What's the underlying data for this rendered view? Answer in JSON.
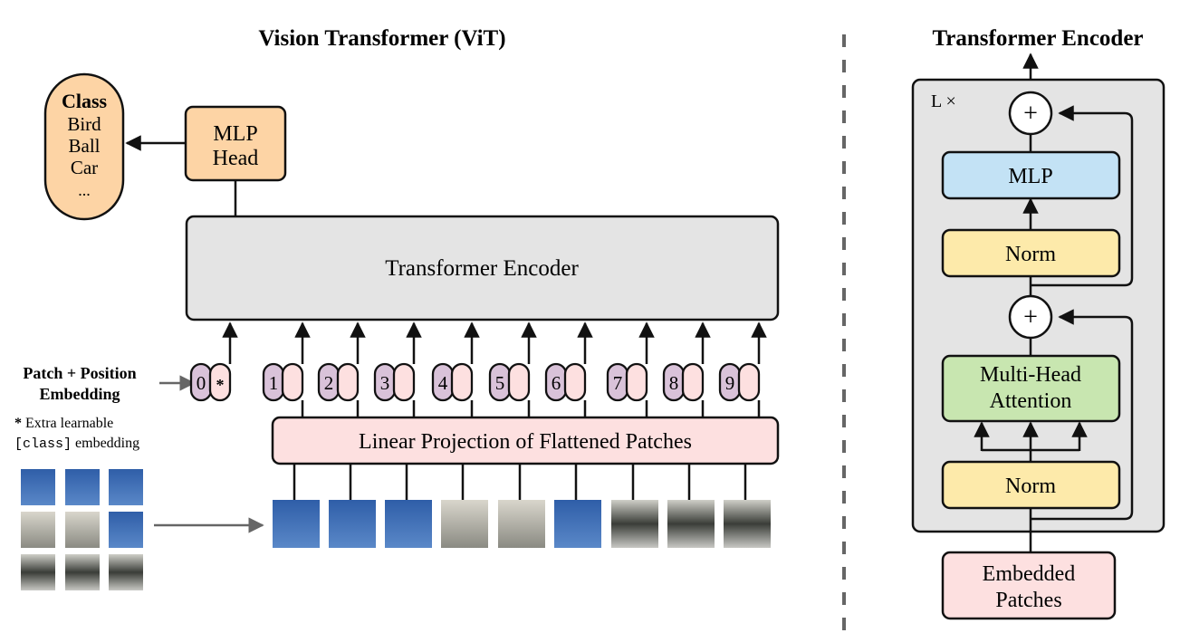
{
  "vit": {
    "title": "Vision Transformer (ViT)",
    "class_box": {
      "heading": "Class",
      "items": [
        "Bird",
        "Ball",
        "Car",
        "..."
      ]
    },
    "mlp_head": {
      "lines": [
        "MLP",
        "Head"
      ]
    },
    "encoder_label": "Transformer Encoder",
    "embedding_label": {
      "lines": [
        "Patch + Position",
        "Embedding"
      ]
    },
    "extra_note": {
      "star": "*",
      "line1": "Extra learnable",
      "code": "[class]",
      "line2": " embedding"
    },
    "tokens": [
      {
        "index": "0",
        "extra": "*"
      },
      {
        "index": "1",
        "extra": ""
      },
      {
        "index": "2",
        "extra": ""
      },
      {
        "index": "3",
        "extra": ""
      },
      {
        "index": "4",
        "extra": ""
      },
      {
        "index": "5",
        "extra": ""
      },
      {
        "index": "6",
        "extra": ""
      },
      {
        "index": "7",
        "extra": ""
      },
      {
        "index": "8",
        "extra": ""
      },
      {
        "index": "9",
        "extra": ""
      }
    ],
    "projection_label": "Linear Projection of Flattened Patches",
    "patch_count": 9
  },
  "encoder_block": {
    "title": "Transformer Encoder",
    "repeat_label": "L ×",
    "plus": "+",
    "mlp": "MLP",
    "norm": "Norm",
    "attention": [
      "Multi-Head",
      "Attention"
    ],
    "embedded": [
      "Embedded",
      "Patches"
    ]
  },
  "colors": {
    "class": "#fdd4a5",
    "encoder": "#e4e4e4",
    "pos": "#d9c2d9",
    "patch": "#fde0e0",
    "mlp": "#c3e2f5",
    "norm": "#fdeaaa",
    "attn": "#c8e6b0",
    "arrow_gray": "#666666"
  }
}
